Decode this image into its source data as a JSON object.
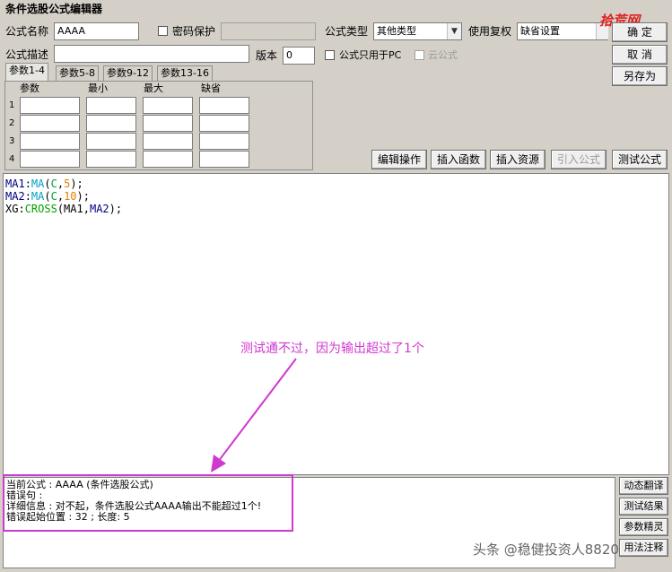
{
  "window": {
    "title": "条件选股公式编辑器"
  },
  "form": {
    "name_label": "公式名称",
    "name_value": "AAAA",
    "password_label": "密码保护",
    "type_label": "公式类型",
    "type_value": "其他类型",
    "rights_label": "使用复权",
    "rights_value": "缺省设置",
    "desc_label": "公式描述",
    "desc_value": "",
    "version_label": "版本",
    "version_value": "0",
    "pc_only_label": "公式只用于PC",
    "cloud_label": "云公式"
  },
  "buttons": {
    "ok": "确 定",
    "cancel": "取 消",
    "save_as": "另存为",
    "edit_ops": "编辑操作",
    "insert_func": "插入函数",
    "insert_res": "插入资源",
    "import_formula": "引入公式",
    "test_formula": "测试公式",
    "dynamic_translate": "动态翻译",
    "test_result": "测试结果",
    "param_wizard": "参数精灵",
    "usage_note": "用法注释"
  },
  "tabs": [
    "参数1-4",
    "参数5-8",
    "参数9-12",
    "参数13-16"
  ],
  "params": {
    "headers": [
      "参数",
      "最小",
      "最大",
      "缺省"
    ],
    "rows": [
      "1",
      "2",
      "3",
      "4"
    ]
  },
  "code": {
    "line1": {
      "var": "MA1",
      "colon": ":",
      "fn": "MA",
      "open": "(",
      "arg": "C",
      "comma": ",",
      "num": "5",
      "close": ");"
    },
    "line2": {
      "var": "MA2",
      "colon": ":",
      "fn": "MA",
      "open": "(",
      "arg": "C",
      "comma": ",",
      "num": "10",
      "close": ");"
    },
    "line3": {
      "var": "XG",
      "colon": ":",
      "fn": "CROSS",
      "open": "(",
      "a1": "MA1",
      "comma": ",",
      "a2": "MA2",
      "close": ");"
    }
  },
  "annotation": {
    "text": "测试通不过，因为输出超过了1个",
    "color": "#d038d0"
  },
  "output": {
    "line1": "当前公式 : AAAA (条件选股公式)",
    "line2": "错误句 :",
    "line3": "详细信息 : 对不起，条件选股公式AAAA输出不能超过1个!",
    "line4": "错误起始位置 : 32 ; 长度: 5"
  },
  "watermarks": {
    "logo": "拾荒网",
    "credit": "头条 @稳健投资人8820"
  },
  "colors": {
    "accent_pink": "#d038d0",
    "logo_red": "#e02020"
  }
}
